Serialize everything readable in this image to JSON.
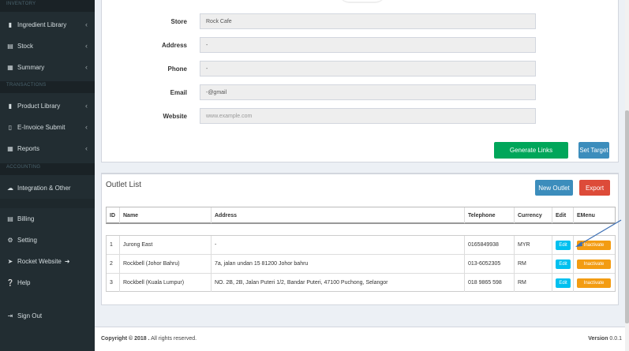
{
  "sidebar": {
    "section_inventory": "INVENTORY",
    "section_transactions": "TRANSACTIONS",
    "section_accounting": "ACCOUNTING",
    "items": {
      "ingredient_library": "Ingredient Library",
      "stock": "Stock",
      "summary": "Summary",
      "product_library": "Product Library",
      "einvoice_submit": "E-Invoice Submit",
      "reports": "Reports",
      "integration": "Integration & Other",
      "billing": "Billing",
      "setting": "Setting",
      "rocket_website": "Rocket Website",
      "help": "Help",
      "sign_out": "Sign Out"
    }
  },
  "store_form": {
    "store_label": "Store",
    "store_value": "Rock Cafe",
    "address_label": "Address",
    "address_value": "-",
    "phone_label": "Phone",
    "phone_value": "-",
    "email_label": "Email",
    "email_value": "-@gmail",
    "website_label": "Website",
    "website_placeholder": "www.example.com",
    "generate_links_label": "Generate Links",
    "set_target_label": "Set Target"
  },
  "outlet_list": {
    "title": "Outlet List",
    "new_outlet_label": "New Outlet",
    "export_label": "Export",
    "columns": [
      "ID",
      "Name",
      "Address",
      "Telephone",
      "Currency",
      "Edit",
      "EMenu"
    ],
    "rows": [
      {
        "id": "1",
        "name": "Jurong East",
        "address": "-",
        "telephone": "0165849938",
        "currency": "MYR",
        "edit": "Edit",
        "emenu": "Inactivate"
      },
      {
        "id": "2",
        "name": "Rockbell (Johor Bahru)",
        "address": "7a, jalan undan 15 81200 Johor bahru",
        "telephone": "013-6052305",
        "currency": "RM",
        "edit": "Edit",
        "emenu": "Inactivate"
      },
      {
        "id": "3",
        "name": "Rockbell (Kuala Lumpur)",
        "address": "NO. 2B, 2B, Jalan Puteri 1/2, Bandar Puteri, 47100 Puchong, Selangor",
        "telephone": "018 9865 598",
        "currency": "RM",
        "edit": "Edit",
        "emenu": "Inactivate"
      }
    ]
  },
  "footer": {
    "copyright_bold": "Copyright © 2018 .",
    "copyright_rest": " All rights reserved.",
    "version_label": "Version",
    "version_value": " 0.0.1"
  },
  "colors": {
    "sidebar_bg": "#222d32",
    "green": "#00a65a",
    "blue": "#3c8dbc",
    "red": "#dd4b39",
    "cyan": "#00c0ef",
    "orange": "#f39c12"
  }
}
